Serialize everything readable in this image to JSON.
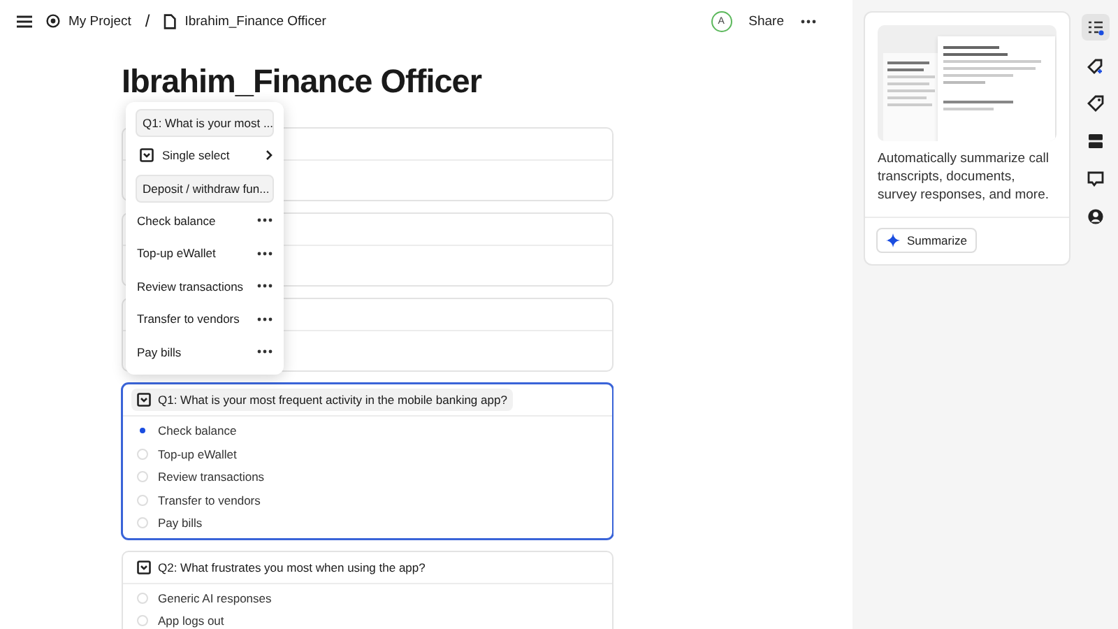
{
  "topbar": {
    "project": "My Project",
    "separator": "/",
    "document": "Ibrahim_Finance Officer",
    "avatar": "A",
    "share": "Share"
  },
  "title": "Ibrahim_Finance Officer",
  "menu": {
    "question": "Q1: What is your most ...",
    "type": "Single select",
    "section": "Deposit / withdraw fun...",
    "options": [
      {
        "label": "Check balance"
      },
      {
        "label": "Top-up eWallet"
      },
      {
        "label": "Review transactions"
      },
      {
        "label": "Transfer to vendors"
      },
      {
        "label": "Pay bills"
      }
    ]
  },
  "questions": [
    {
      "title": "Q1: What is your most frequent activity in the mobile banking app?",
      "focused": true,
      "options": [
        {
          "label": "Check balance",
          "selected": true
        },
        {
          "label": "Top-up eWallet",
          "selected": false
        },
        {
          "label": "Review transactions",
          "selected": false
        },
        {
          "label": "Transfer to vendors",
          "selected": false
        },
        {
          "label": "Pay bills",
          "selected": false
        }
      ]
    },
    {
      "title": "Q2: What frustrates you most when using the app?",
      "focused": false,
      "options": [
        {
          "label": "Generic AI responses",
          "selected": false
        },
        {
          "label": "App logs out",
          "selected": false
        }
      ]
    }
  ],
  "summary_panel": {
    "description": "Automatically summarize call transcripts, documents, survey responses, and more.",
    "button": "Summarize"
  },
  "side_tools": [
    {
      "kind": "list",
      "selected": true
    },
    {
      "kind": "tag-plus",
      "selected": false
    },
    {
      "kind": "tag",
      "selected": false
    },
    {
      "kind": "stack",
      "selected": false
    },
    {
      "kind": "comment",
      "selected": false
    },
    {
      "kind": "person",
      "selected": false
    }
  ]
}
